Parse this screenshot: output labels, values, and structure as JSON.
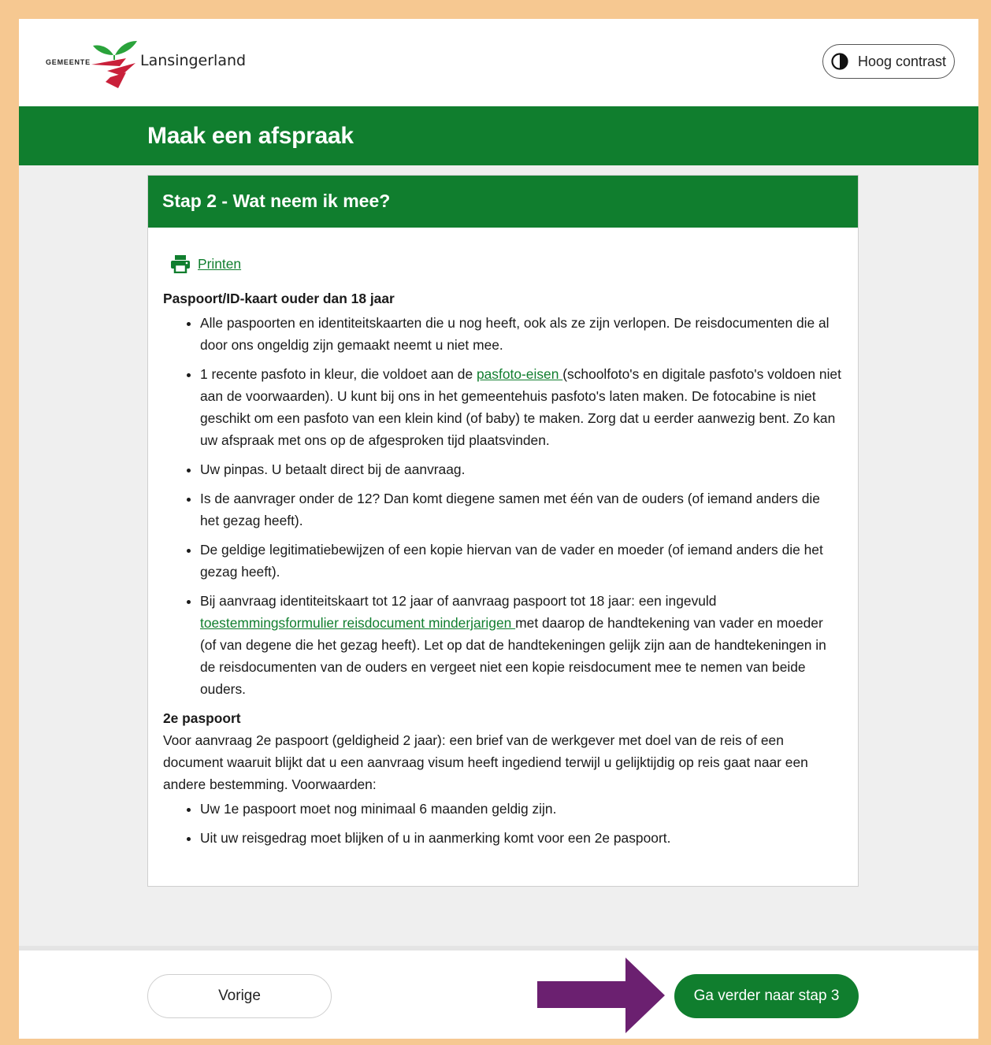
{
  "header": {
    "logo_small": "GEMEENTE",
    "logo_name": "Lansingerland",
    "contrast_label": "Hoog contrast",
    "contrast_icon": "contrast-icon"
  },
  "page": {
    "title": "Maak een afspraak"
  },
  "step": {
    "title": "Stap 2 - Wat neem ik mee?",
    "print_label": "Printen",
    "print_icon": "printer-icon",
    "section1": {
      "heading": "Paspoort/ID-kaart ouder dan 18 jaar",
      "item1": "Alle paspoorten en identiteitskaarten die u nog heeft, ook als ze zijn verlopen. De reisdocumenten die al door ons ongeldig zijn gemaakt neemt u niet mee.",
      "item2_pre": "1 recente pasfoto in kleur, die voldoet aan de ",
      "item2_link": "pasfoto-eisen ",
      "item2_post": "(schoolfoto's en digitale pasfoto's voldoen niet aan de voorwaarden). U kunt bij ons in het gemeentehuis pasfoto's laten maken. De fotocabine is niet geschikt om een pasfoto van een klein kind (of baby) te maken. Zorg dat u eerder aanwezig bent. Zo kan uw afspraak met ons op de afgesproken tijd plaatsvinden.",
      "item3": "Uw pinpas. U betaalt direct bij de aanvraag.",
      "item4": "Is de aanvrager onder de 12? Dan komt diegene samen met één van de ouders (of iemand anders die het gezag heeft).",
      "item5": "De geldige legitimatiebewijzen of een kopie hiervan van de vader en moeder (of iemand anders die het gezag heeft).",
      "item6_pre": "Bij aanvraag identiteitskaart tot 12 jaar of aanvraag paspoort tot 18 jaar: een ingevuld ",
      "item6_link": "toestemmingsformulier reisdocument minderjarigen ",
      "item6_post": "met daarop de handtekening van vader en moeder (of van degene die het gezag heeft). Let op dat de handtekeningen gelijk zijn aan de handtekeningen in de reisdocumenten van de ouders en vergeet niet een kopie reisdocument mee te nemen van beide ouders."
    },
    "section2": {
      "heading": "2e paspoort",
      "intro": "Voor aanvraag 2e paspoort (geldigheid 2 jaar): een brief van de werkgever met doel van de reis of een document waaruit blijkt dat u een aanvraag visum heeft ingediend terwijl u gelijktijdig op reis gaat naar een andere bestemming. Voorwaarden:",
      "item1": "Uw 1e paspoort moet nog minimaal 6 maanden geldig zijn.",
      "item2": "Uit uw reisgedrag moet blijken of u in aanmerking komt voor een 2e paspoort."
    }
  },
  "footer": {
    "prev_label": "Vorige",
    "next_label": "Ga verder naar stap 3"
  },
  "colors": {
    "brand_green": "#107e2e",
    "frame_orange": "#f6c891",
    "arrow_purple": "#6b2070"
  }
}
